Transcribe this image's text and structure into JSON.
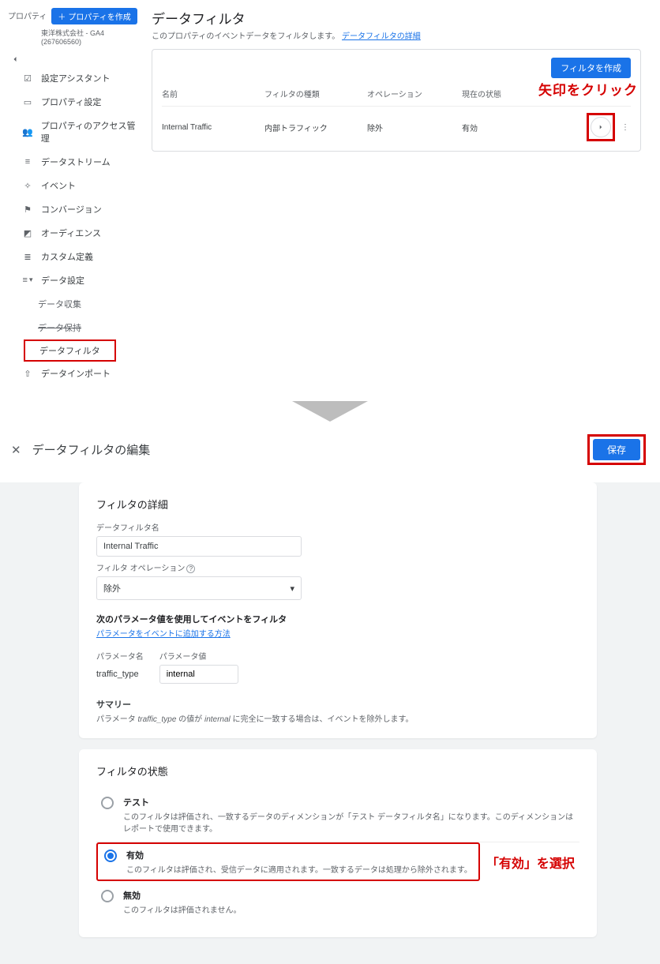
{
  "sidebar": {
    "property_label": "プロパティ",
    "create_property_btn": "プロパティを作成",
    "account_line": "東洋株式会社 - GA4 (267606560)",
    "items": [
      {
        "label": "設定アシスタント"
      },
      {
        "label": "プロパティ設定"
      },
      {
        "label": "プロパティのアクセス管理"
      },
      {
        "label": "データストリーム"
      },
      {
        "label": "イベント"
      },
      {
        "label": "コンバージョン"
      },
      {
        "label": "オーディエンス"
      },
      {
        "label": "カスタム定義"
      },
      {
        "label": "データ設定"
      },
      {
        "label": "データ収集"
      },
      {
        "label": "データ保持"
      },
      {
        "label": "データフィルタ"
      },
      {
        "label": "データインポート"
      }
    ]
  },
  "main": {
    "title": "データフィルタ",
    "subtitle_a": "このプロパティのイベントデータをフィルタします。",
    "subtitle_link": "データフィルタの詳細",
    "create_filter_btn": "フィルタを作成",
    "cols": {
      "name": "名前",
      "type": "フィルタの種類",
      "op": "オペレーション",
      "state": "現在の状態"
    },
    "row": {
      "name": "Internal Traffic",
      "type": "内部トラフィック",
      "op": "除外",
      "state": "有効"
    }
  },
  "annotations": {
    "arrow_click": "矢印をクリック",
    "select_active": "「有効」を選択"
  },
  "edit": {
    "title": "データフィルタの編集",
    "save_btn": "保存",
    "details_heading": "フィルタの詳細",
    "filter_name_label": "データフィルタ名",
    "filter_name_value": "Internal Traffic",
    "op_label": "フィルタ オペレーション",
    "op_value": "除外",
    "param_section_title": "次のパラメータ値を使用してイベントをフィルタ",
    "param_link": "パラメータをイベントに追加する方法",
    "param_name_label": "パラメータ名",
    "param_val_label": "パラメータ値",
    "param_name_value": "traffic_type",
    "param_val_value": "internal",
    "summary_title": "サマリー",
    "summary_text_a": "パラメータ ",
    "summary_text_b": " の値が ",
    "summary_text_c": " に完全に一致する場合は、イベントを除外します。",
    "status_heading": "フィルタの状態",
    "status": [
      {
        "label": "テスト",
        "desc": "このフィルタは評価され、一致するデータのディメンションが「テスト データフィルタ名」になります。このディメンションはレポートで使用できます。"
      },
      {
        "label": "有効",
        "desc": "このフィルタは評価され、受信データに適用されます。一致するデータは処理から除外されます。"
      },
      {
        "label": "無効",
        "desc": "このフィルタは評価されません。"
      }
    ]
  }
}
